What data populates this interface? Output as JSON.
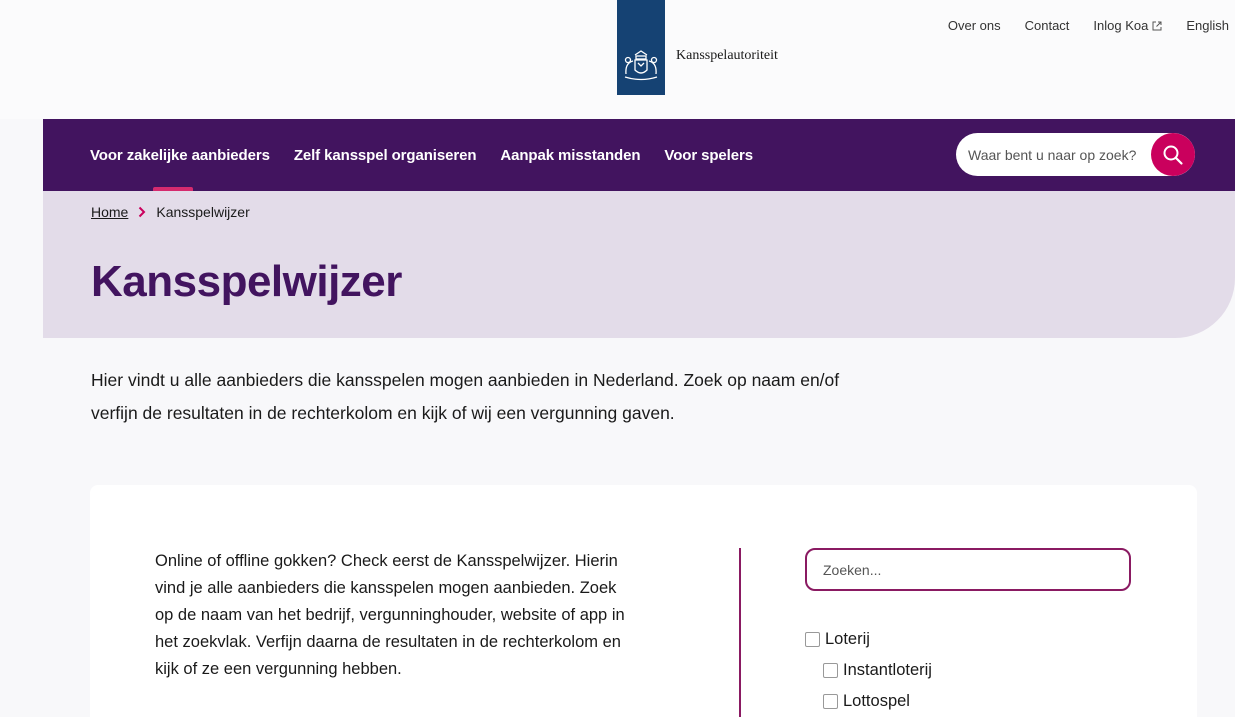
{
  "header": {
    "organisation": "Kansspelautoriteit",
    "utility_links": [
      "Over ons",
      "Contact",
      "Inlog Koa",
      "English"
    ]
  },
  "nav": {
    "items": [
      "Voor zakelijke aanbieders",
      "Zelf kansspel organiseren",
      "Aanpak misstanden",
      "Voor spelers"
    ],
    "search_placeholder": "Waar bent u naar op zoek?"
  },
  "breadcrumb": {
    "home": "Home",
    "current": "Kansspelwijzer"
  },
  "page": {
    "title": "Kansspelwijzer",
    "intro": "Hier vindt u alle aanbieders die kansspelen mogen aanbieden in Nederland. Zoek op naam en/of verfijn de resultaten in de rechterkolom en kijk of wij een vergunning gaven."
  },
  "card": {
    "text": "Online of offline gokken? Check eerst de Kansspelwijzer. Hierin vind je alle aanbieders die kansspelen mogen aanbieden. Zoek op de naam van het bedrijf, vergunninghouder, website of app in het zoekvlak. Verfijn daarna de resultaten in de rechterkolom en kijk of ze een vergunning hebben.",
    "search_placeholder": "Zoeken...",
    "filters": [
      {
        "label": "Loterij",
        "checked": false
      },
      {
        "label": "Instantloterij",
        "checked": false
      },
      {
        "label": "Lottospel",
        "checked": false
      }
    ]
  },
  "colors": {
    "primary_purple": "#42145f",
    "accent_pink": "#ca005d",
    "rijks_blue": "#154273",
    "hero_bg": "#e3dce9"
  }
}
